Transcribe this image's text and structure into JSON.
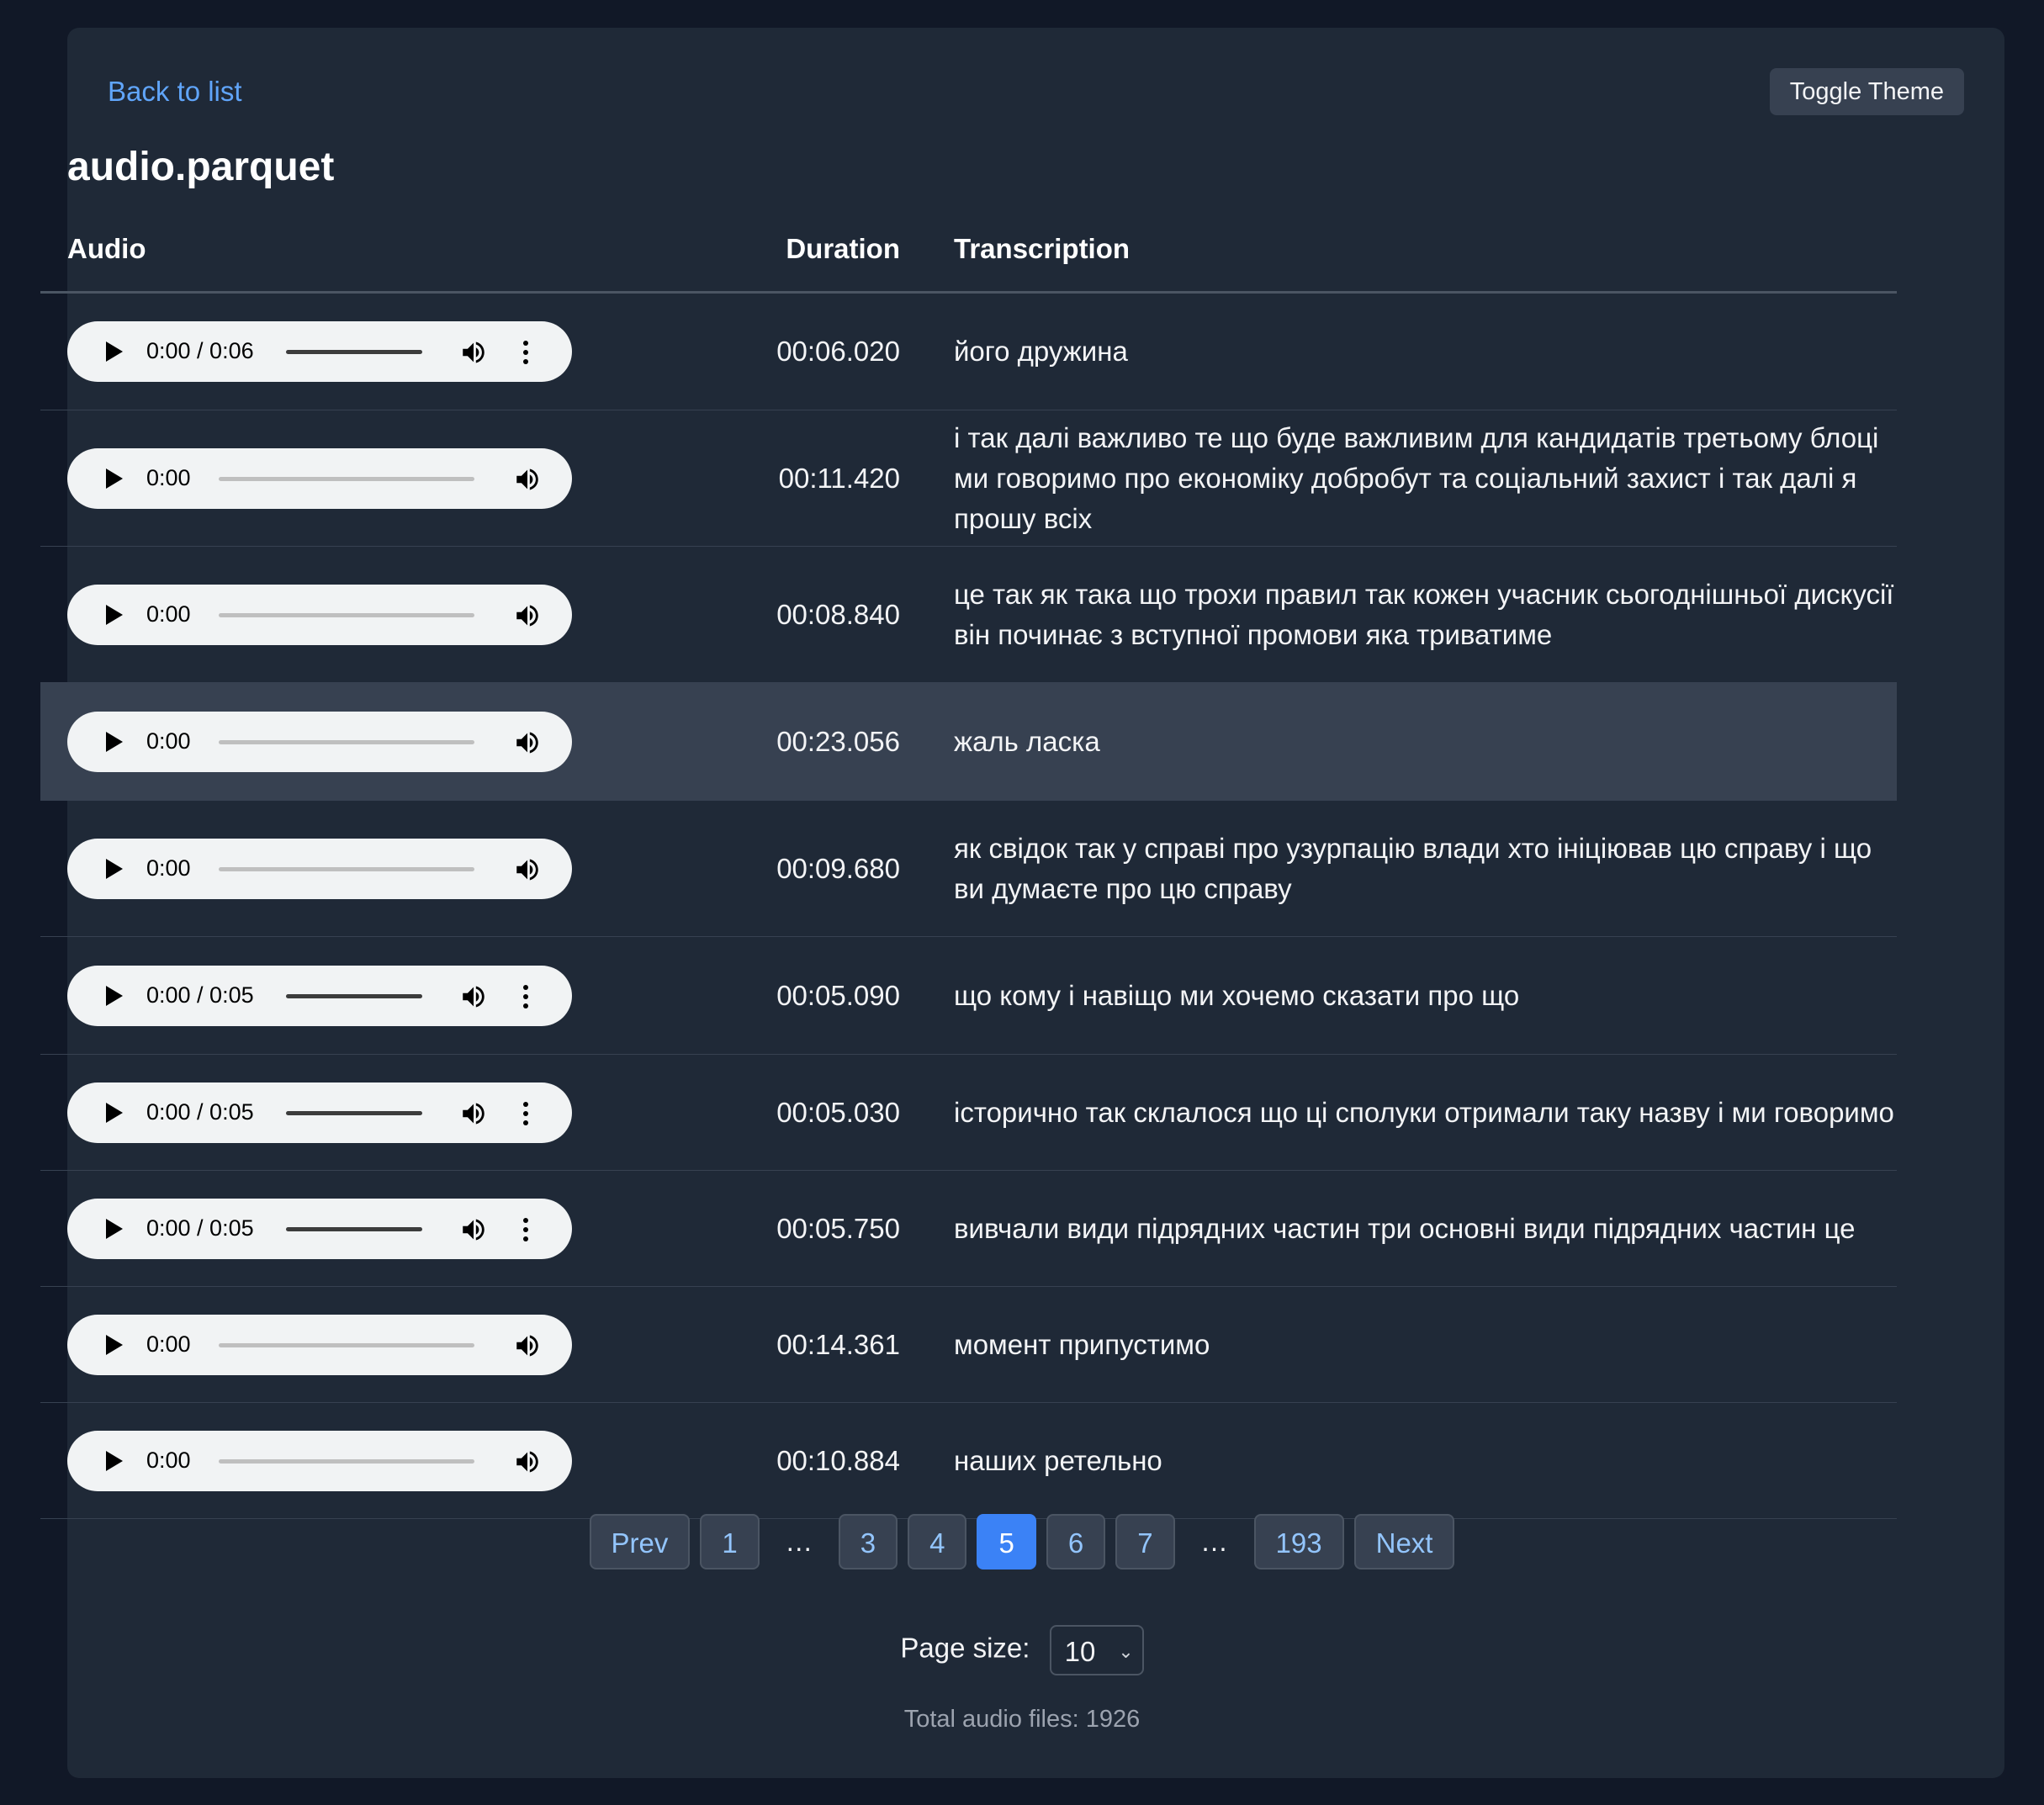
{
  "header": {
    "back_label": "Back to list",
    "toggle_label": "Toggle Theme",
    "title": "audio.parquet"
  },
  "table": {
    "columns": [
      "Audio",
      "Duration",
      "Transcription"
    ],
    "rows": [
      {
        "player_time": "0:00 / 0:06",
        "player_style": "long",
        "duration": "00:06.020",
        "transcription": "його дружина"
      },
      {
        "player_time": "0:00",
        "player_style": "short",
        "duration": "00:11.420",
        "transcription": "і так далі важливо те що буде важливим для кандидатів третьому блоці ми говоримо про економіку добробут та соціальний захист і так далі я прошу всіх"
      },
      {
        "player_time": "0:00",
        "player_style": "short",
        "duration": "00:08.840",
        "transcription": "це так як така що трохи правил так кожен учасник сьогоднішньої дискусії він починає з вступної промови яка триватиме"
      },
      {
        "player_time": "0:00",
        "player_style": "short",
        "duration": "00:23.056",
        "transcription": "жаль ласка",
        "highlighted": true
      },
      {
        "player_time": "0:00",
        "player_style": "short",
        "duration": "00:09.680",
        "transcription": "як свідок так у справі про узурпацію влади хто ініціював цю справу і що ви думаєте про цю справу"
      },
      {
        "player_time": "0:00 / 0:05",
        "player_style": "long",
        "duration": "00:05.090",
        "transcription": "що кому і навіщо ми хочемо сказати про що"
      },
      {
        "player_time": "0:00 / 0:05",
        "player_style": "long",
        "duration": "00:05.030",
        "transcription": "історично так склалося що ці сполуки отримали таку назву і ми говоримо"
      },
      {
        "player_time": "0:00 / 0:05",
        "player_style": "long",
        "duration": "00:05.750",
        "transcription": "вивчали види підрядних частин три основні види підрядних частин це"
      },
      {
        "player_time": "0:00",
        "player_style": "short",
        "duration": "00:14.361",
        "transcription": "момент припустимо"
      },
      {
        "player_time": "0:00",
        "player_style": "short",
        "duration": "00:10.884",
        "transcription": "наших ретельно"
      }
    ]
  },
  "pagination": {
    "prev_label": "Prev",
    "next_label": "Next",
    "items": [
      "1",
      "…",
      "3",
      "4",
      "5",
      "6",
      "7",
      "…",
      "193"
    ],
    "current": "5"
  },
  "page_size": {
    "label": "Page size:",
    "value": "10"
  },
  "total_label": "Total audio files: 1926",
  "colors": {
    "accent": "#3b82f6",
    "link": "#60a5fa",
    "background": "#111827",
    "card": "#1f2937"
  }
}
